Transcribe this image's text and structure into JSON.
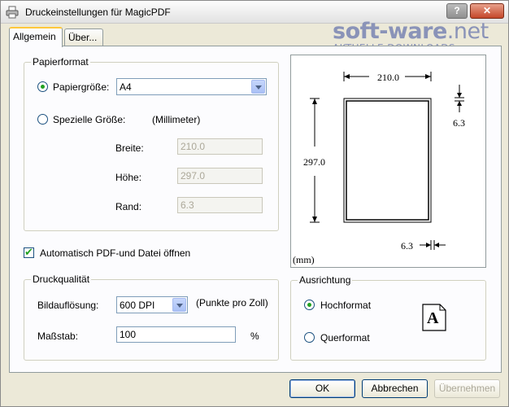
{
  "window": {
    "title": "Druckeinstellungen für MagicPDF",
    "help_label": "?",
    "close_label": "✕"
  },
  "watermark": {
    "main": "soft-ware",
    "suffix": ".net",
    "sub": "AKTUELLE DOWNLOADS"
  },
  "tabs": [
    {
      "label": "Allgemein",
      "active": true
    },
    {
      "label": "Über...",
      "active": false
    }
  ],
  "papierformat": {
    "group_label": "Papierformat",
    "papiergroesse_label": "Papiergröße:",
    "papiergroesse_value": "A4",
    "spezielle_label": "Spezielle Größe:",
    "unit_hint": "(Millimeter)",
    "breite_label": "Breite:",
    "breite_value": "210.0",
    "hoehe_label": "Höhe:",
    "hoehe_value": "297.0",
    "rand_label": "Rand:",
    "rand_value": "6.3"
  },
  "auto_open": {
    "label": "Automatisch PDF-und Datei öffnen",
    "checked": true
  },
  "druckqualitaet": {
    "group_label": "Druckqualität",
    "bildaufloesung_label": "Bildauflösung:",
    "bildaufloesung_value": "600 DPI",
    "dpi_hint": "(Punkte pro Zoll)",
    "massstab_label": "Maßstab:",
    "massstab_value": "100",
    "percent": "%"
  },
  "preview": {
    "width_label": "210.0",
    "height_label": "297.0",
    "margin_label_top": "6.3",
    "margin_label_bottom": "6.3",
    "unit_label": "(mm)"
  },
  "ausrichtung": {
    "group_label": "Ausrichtung",
    "hochformat_label": "Hochformat",
    "querformat_label": "Querformat",
    "selected": "Hochformat",
    "icon_letter": "A"
  },
  "buttons": {
    "ok": "OK",
    "abbrechen": "Abbrechen",
    "uebernehmen": "Übernehmen"
  },
  "colors": {
    "dialog_bg": "#ece9d8",
    "panel_bg": "#fcfcfe",
    "accent_checked": "#21a121",
    "watermark": "#8a93b8"
  }
}
